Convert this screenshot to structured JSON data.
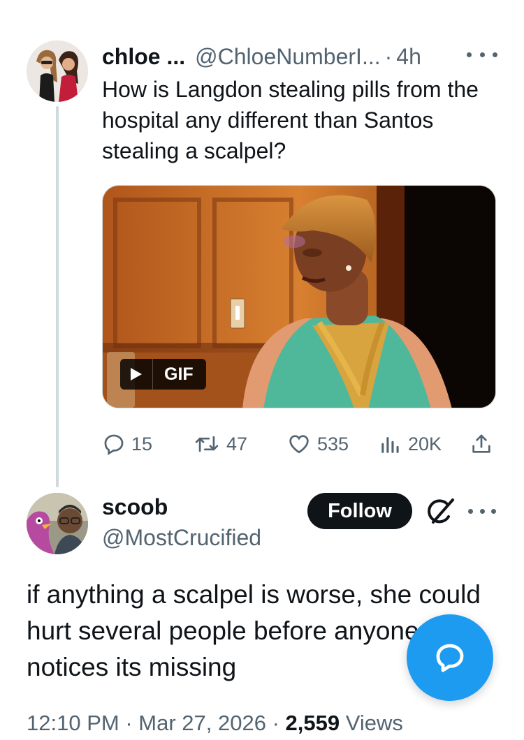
{
  "colors": {
    "text_primary": "#0f1419",
    "text_secondary": "#536471",
    "accent_blue": "#1d9bf0",
    "thread_line": "#cfd9de",
    "follow_button_bg": "#0f1419"
  },
  "tweet": {
    "author_name": "chloe ...",
    "handle": "@ChloeNumberI...",
    "separator": "·",
    "time_ago": "4h",
    "text": "How is Langdon stealing pills from the hospital any different than Santos stealing a scalpel?",
    "media": {
      "type": "gif",
      "badge_label": "GIF",
      "icons": [
        "play-icon"
      ]
    },
    "stats": {
      "replies": "15",
      "retweets": "47",
      "likes": "535",
      "views": "20K"
    },
    "icons": [
      "reply-icon",
      "retweet-icon",
      "like-icon",
      "views-icon",
      "share-icon",
      "more-icon"
    ]
  },
  "reply": {
    "author_name": "scoob",
    "handle": "@MostCrucified",
    "follow_label": "Follow",
    "text": "if anything a scalpel is worse, she could hurt several people before anyone even notices its missing",
    "meta": {
      "time": "12:10 PM",
      "date": "Mar 27, 2026",
      "separator": "·",
      "views_count": "2,559",
      "views_label": "Views"
    },
    "icons": [
      "grok-icon",
      "more-icon"
    ]
  },
  "fab": {
    "icon": "compose-reply-icon"
  }
}
